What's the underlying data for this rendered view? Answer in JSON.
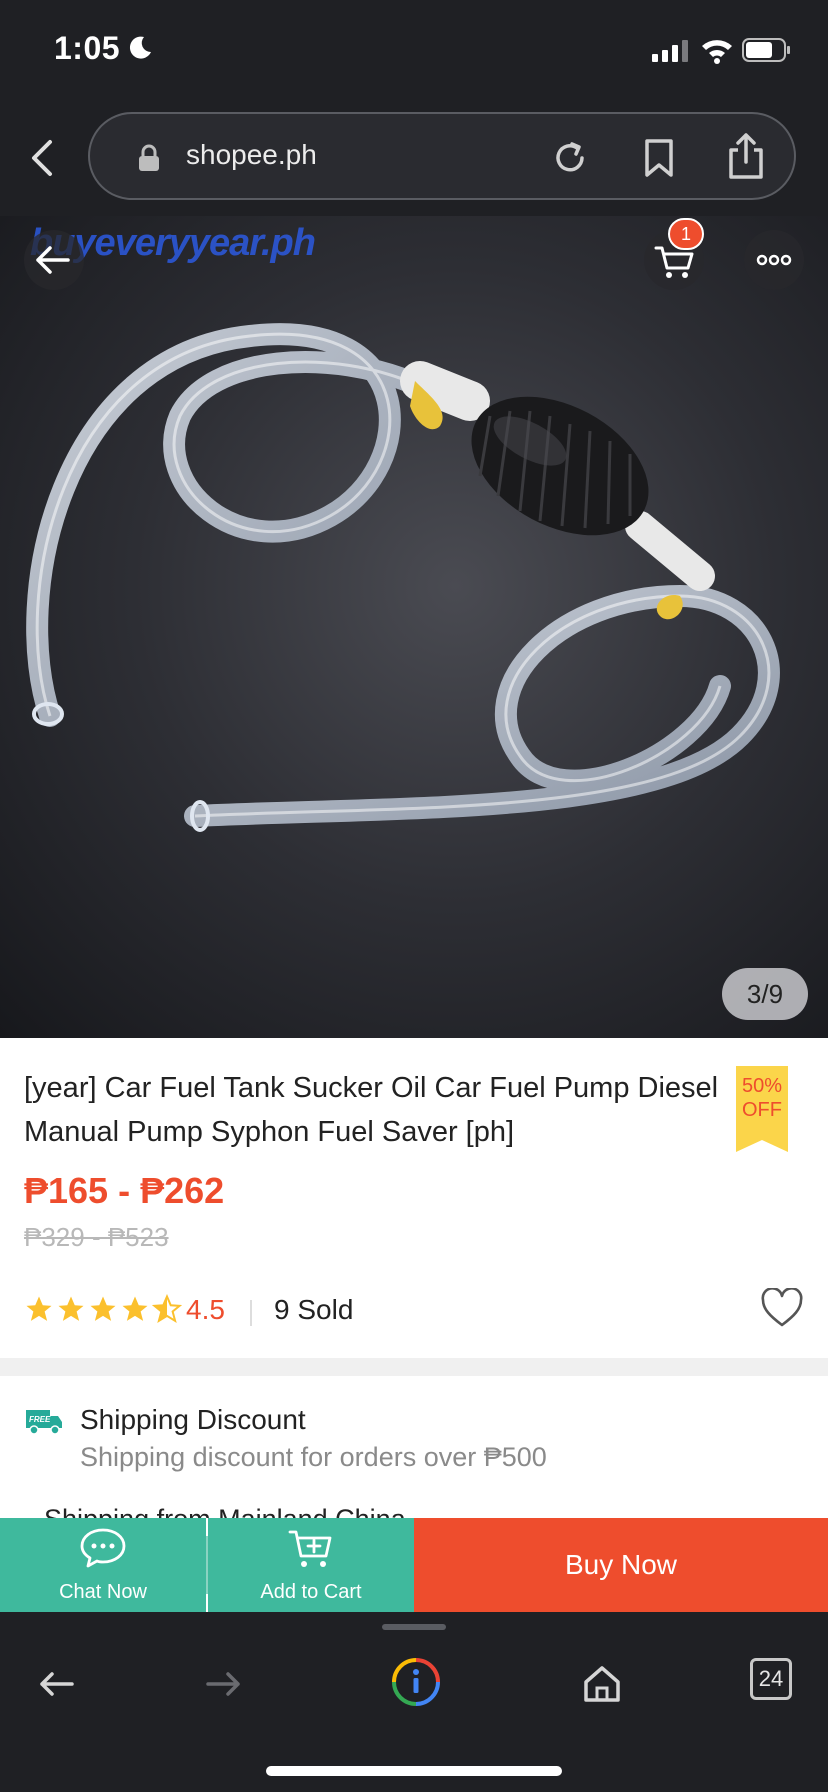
{
  "status_bar": {
    "time": "1:05"
  },
  "browser": {
    "url": "shopee.ph",
    "tab_count": "24"
  },
  "product": {
    "watermark": "buyeveryyear.ph",
    "cart_badge": "1",
    "image_counter": "3/9",
    "title": "[year] Car Fuel Tank Sucker Oil Car Fuel Pump Diesel Manual Pump Syphon Fuel Saver [ph]",
    "discount_line1": "50%",
    "discount_line2": "OFF",
    "price": "₱165 - ₱262",
    "original_price": "₱329 - ₱523",
    "rating": "4.5",
    "sold": "9 Sold"
  },
  "shipping": {
    "badge": "FREE",
    "title": "Shipping Discount",
    "description": "Shipping discount for orders over ₱500",
    "next_line": "Shipping from Mainland China"
  },
  "actions": {
    "chat_label": "Chat Now",
    "cart_label": "Add to Cart",
    "buy_label": "Buy Now"
  },
  "colors": {
    "brand": "#ee4d2d",
    "action_green": "#3fb99d",
    "star": "#fbc02d"
  }
}
